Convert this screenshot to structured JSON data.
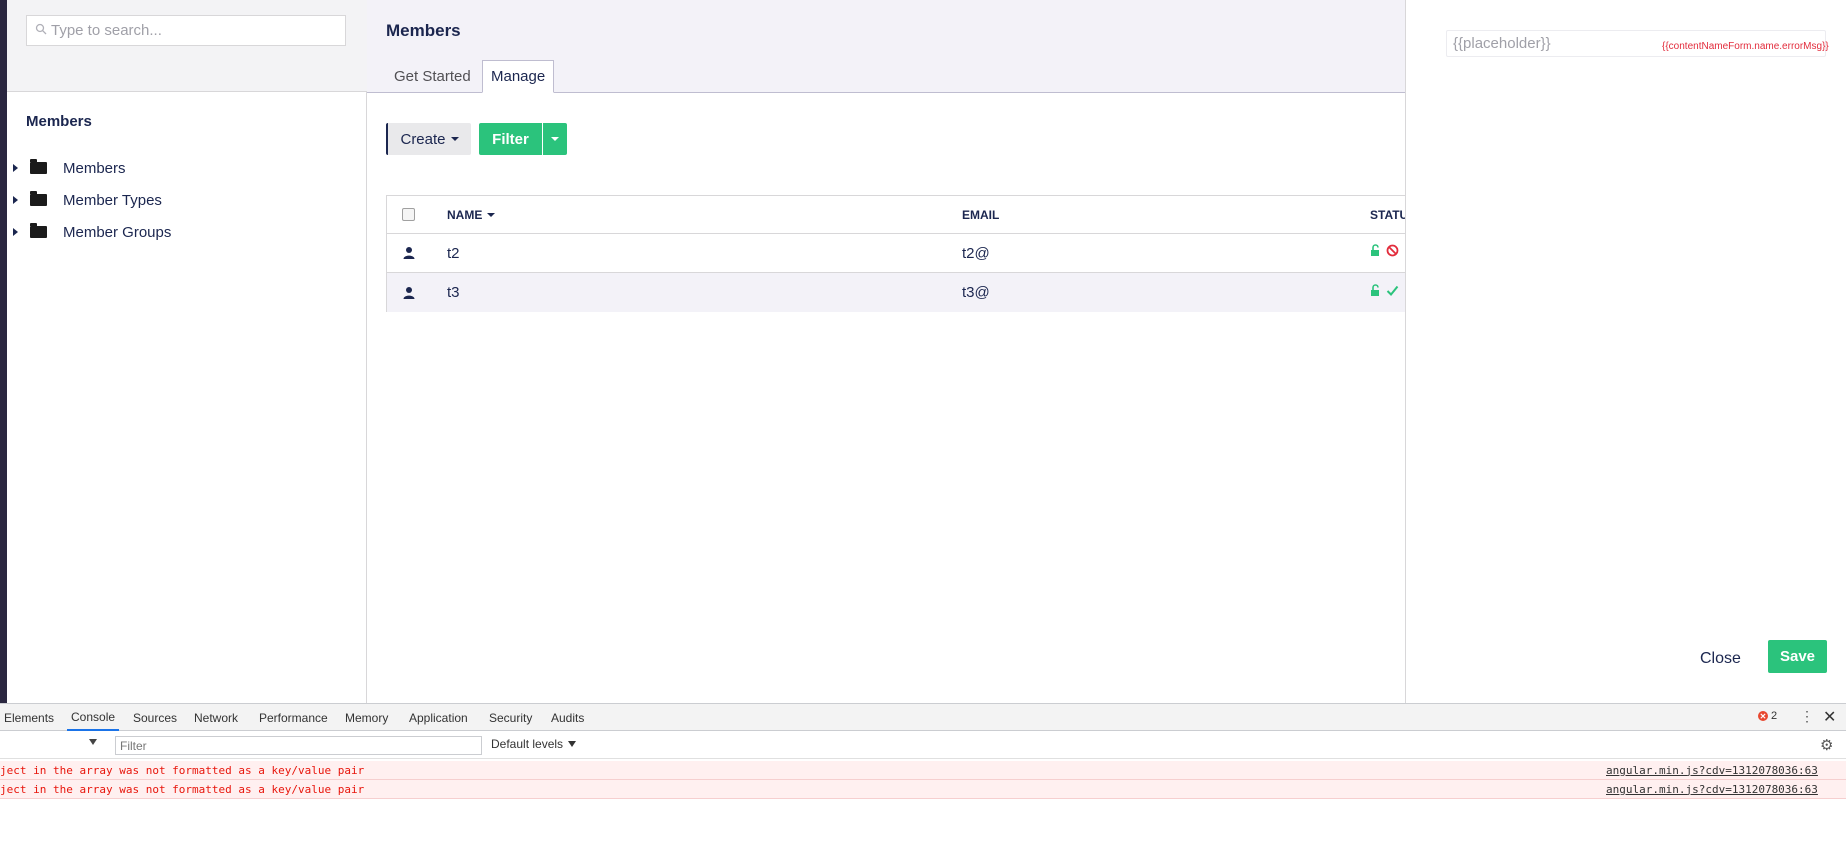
{
  "tree": {
    "search_placeholder": "Type to search...",
    "section_title": "Members",
    "items": [
      {
        "label": "Members"
      },
      {
        "label": "Member Types"
      },
      {
        "label": "Member Groups"
      }
    ]
  },
  "main": {
    "title": "Members",
    "tabs": [
      {
        "label": "Get Started",
        "active": false
      },
      {
        "label": "Manage",
        "active": true
      }
    ],
    "toolbar": {
      "create_label": "Create",
      "filter_label": "Filter"
    },
    "table": {
      "columns": [
        "NAME",
        "EMAIL",
        "STATU"
      ],
      "sorted_by": "NAME",
      "rows": [
        {
          "name": "t2",
          "email": "t2@",
          "status_icons": [
            "unlock-icon",
            "blocked-icon"
          ]
        },
        {
          "name": "t3",
          "email": "t3@",
          "status_icons": [
            "unlock-icon",
            "check-icon"
          ]
        }
      ]
    }
  },
  "right_panel": {
    "input_placeholder": "{{placeholder}}",
    "validation_text": "{{contentNameForm.name.errorMsg}}",
    "close_label": "Close",
    "save_label": "Save"
  },
  "devtools": {
    "tabs": [
      "Elements",
      "Console",
      "Sources",
      "Network",
      "Performance",
      "Memory",
      "Application",
      "Security",
      "Audits"
    ],
    "active_tab": "Console",
    "error_count": "2",
    "filter_placeholder": "Filter",
    "levels_label": "Default levels",
    "messages": [
      {
        "text": "ject in the array was not formatted as a key/value pair",
        "source": "angular.min.js?cdv=1312078036:63"
      },
      {
        "text": "ject in the array was not formatted as a key/value pair",
        "source": "angular.min.js?cdv=1312078036:63"
      }
    ]
  },
  "colors": {
    "accent_green": "#2bc37c",
    "brand_dark": "#1b264f",
    "error_red": "#e22c3c"
  }
}
